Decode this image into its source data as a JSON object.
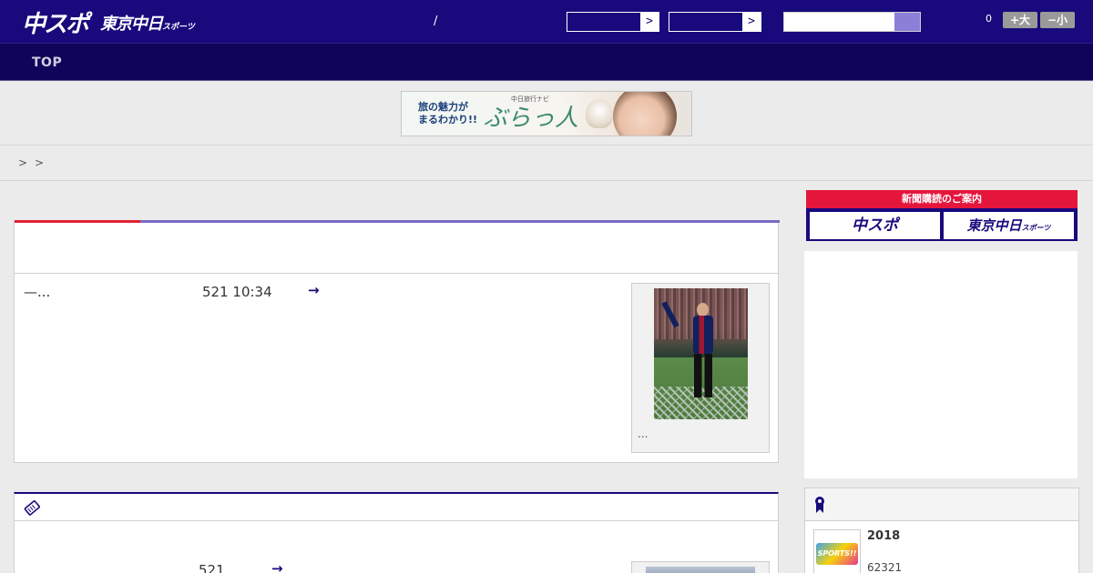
{
  "header": {
    "logo_main": "中スポ",
    "logo_tokyo": "東京中日",
    "logo_tokyo_small": "スポーツ",
    "separator": "/",
    "select1_arrow": ">",
    "select2_arrow": ">",
    "font_count": "0",
    "font_larger": "+大",
    "font_smaller": "−小",
    "colors": {
      "header_bg": "#180a7c",
      "nav_bg": "#0f0459",
      "accent_red": "#e02234",
      "accent_purple": "#7b6ac6"
    }
  },
  "nav": {
    "top_label": "TOP"
  },
  "banner": {
    "line1": "旅の魅力が",
    "line2": "まるわかり!!",
    "sub": "中日旅行ナビ",
    "brand": "ぶらっ人"
  },
  "breadcrumb": {
    "sep1": ">",
    "sep2": ">"
  },
  "article": {
    "text": "—...",
    "date": "521 10:34",
    "arrow": "→",
    "photo_caption": "..."
  },
  "article2": {
    "date": "521",
    "arrow": "→"
  },
  "sidebar": {
    "subscribe_head": "新聞購読のご案内",
    "subscribe_btn1": "中スポ",
    "subscribe_btn2": "東京中日",
    "subscribe_btn2_small": "スポーツ",
    "rank_title": "2018",
    "rank_sub": "62321",
    "rank_thumb_text": "SPORTS!!"
  }
}
